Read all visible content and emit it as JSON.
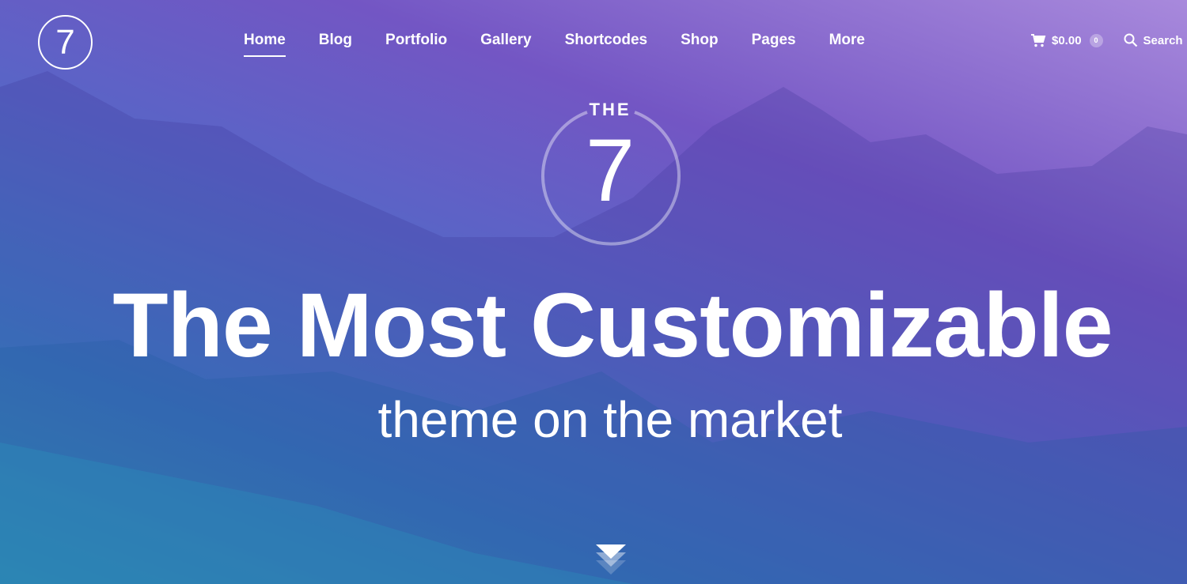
{
  "logo": {
    "text": "7"
  },
  "nav": {
    "items": [
      {
        "label": "Home",
        "active": true
      },
      {
        "label": "Blog"
      },
      {
        "label": "Portfolio"
      },
      {
        "label": "Gallery"
      },
      {
        "label": "Shortcodes"
      },
      {
        "label": "Shop"
      },
      {
        "label": "Pages"
      },
      {
        "label": "More"
      }
    ]
  },
  "cart": {
    "icon": "cart-icon",
    "total": "$0.00",
    "count": "0"
  },
  "search": {
    "icon": "search-icon",
    "label": "Search"
  },
  "hero": {
    "emblem_top": "THE",
    "emblem_number": "7",
    "headline": "The Most Customizable",
    "subheadline": "theme on the market",
    "scroll_icon": "chevrons-down-icon"
  },
  "colors": {
    "gradient_start": "#2fa6c0",
    "gradient_end": "#a889dc",
    "text": "#ffffff"
  }
}
